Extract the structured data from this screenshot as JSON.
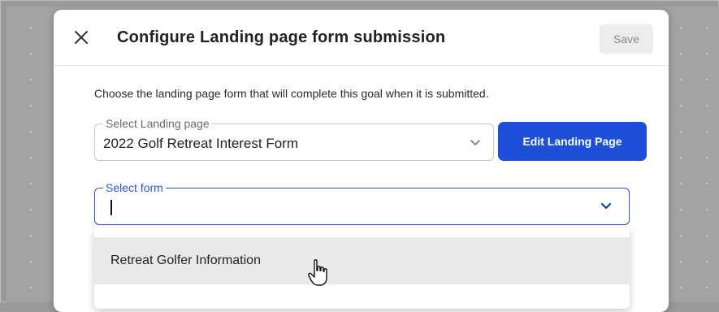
{
  "dialog": {
    "title": "Configure Landing page form submission",
    "save_label": "Save",
    "description": "Choose the landing page form that will complete this goal when it is submitted."
  },
  "landing_page_select": {
    "label": "Select Landing page",
    "value": "2022 Golf Retreat Interest Form"
  },
  "edit_button": {
    "label": "Edit Landing Page"
  },
  "form_select": {
    "label": "Select form",
    "value": "",
    "options": [
      "Retreat Golfer Information"
    ]
  },
  "colors": {
    "accent": "#1d4fd8",
    "focus_border": "#2a56d6",
    "option_hover": "#e9e9e9"
  },
  "icons": {
    "close": "close-icon",
    "chevron": "chevron-down-icon",
    "cursor": "hand-pointer-icon"
  }
}
